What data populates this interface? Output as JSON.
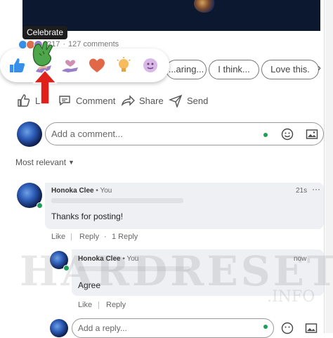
{
  "tooltip": "Celebrate",
  "counts": {
    "reactions": "217",
    "comments": "127 comments"
  },
  "reactions": [
    "like-icon",
    "celebrate-icon",
    "support-icon",
    "love-icon",
    "insightful-icon",
    "funny-icon"
  ],
  "chips": [
    "...aring...",
    "I think...",
    "Love this."
  ],
  "actions": {
    "like": "L",
    "comment": "Comment",
    "share": "Share",
    "send": "Send"
  },
  "comment_input": {
    "placeholder": "Add a comment..."
  },
  "sort": "Most relevant",
  "comments": [
    {
      "name": "Honoka Clee",
      "you": "• You",
      "time": "21s",
      "text": "Thanks for posting!",
      "like": "Like",
      "reply": "Reply",
      "reply_count": "1 Reply"
    }
  ],
  "reply": {
    "name": "Honoka Clee",
    "you": "• You",
    "time": "now",
    "text": "Agree",
    "like": "Like",
    "reply": "Reply"
  },
  "reply_input": {
    "placeholder": "Add a reply..."
  },
  "watermark": {
    "main": "HARDRESET",
    "sub": ".INFO"
  },
  "colors": {
    "like_blue": "#378fe9",
    "green": "#1e9e5a",
    "red_arrow": "#e0201b",
    "text": "#555555"
  }
}
